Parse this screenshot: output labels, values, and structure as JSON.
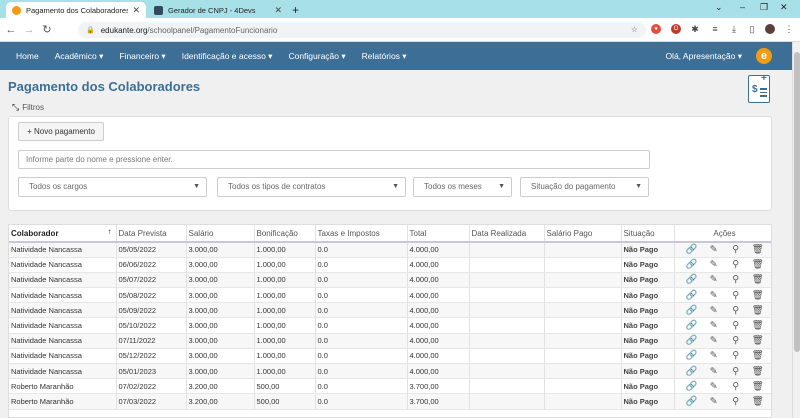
{
  "browser": {
    "tabs": [
      {
        "title": "Pagamento dos Colaboradores",
        "active": true
      },
      {
        "title": "Gerador de CNPJ - 4Devs",
        "active": false
      }
    ],
    "url_host": "edukante.org",
    "url_path": "/schoolpanel/PagamentoFuncionario"
  },
  "nav": {
    "items": [
      "Home",
      "Acadêmico ▾",
      "Financeiro ▾",
      "Identificação e acesso ▾",
      "Configuração ▾",
      "Relatórios ▾"
    ],
    "user": "Olá, Apresentação ▾",
    "logo": "e"
  },
  "page": {
    "title": "Pagamento dos Colaboradores",
    "filters_label": "Filtros",
    "new_button": "+ Novo pagamento",
    "search_placeholder": "Informe parte do nome e pressione enter.",
    "selects": [
      "Todos os cargos",
      "Todos os tipos de contratos",
      "Todos os meses",
      "Situação do pagamento"
    ]
  },
  "table": {
    "headers": [
      "Colaborador",
      "Data Prevista",
      "Salário",
      "Bonificação",
      "Taxas e Impostos",
      "Total",
      "Data Realizada",
      "Salário Pago",
      "Situação",
      "Ações"
    ],
    "rows": [
      [
        "Natividade Nancassa",
        "05/05/2022",
        "3.000,00",
        "1.000,00",
        "0.0",
        "4.000,00",
        "",
        "",
        "Não Pago"
      ],
      [
        "Natividade Nancassa",
        "06/06/2022",
        "3.000,00",
        "1.000,00",
        "0.0",
        "4.000,00",
        "",
        "",
        "Não Pago"
      ],
      [
        "Natividade Nancassa",
        "05/07/2022",
        "3.000,00",
        "1.000,00",
        "0.0",
        "4.000,00",
        "",
        "",
        "Não Pago"
      ],
      [
        "Natividade Nancassa",
        "05/08/2022",
        "3.000,00",
        "1.000,00",
        "0.0",
        "4.000,00",
        "",
        "",
        "Não Pago"
      ],
      [
        "Natividade Nancassa",
        "05/09/2022",
        "3.000,00",
        "1.000,00",
        "0.0",
        "4.000,00",
        "",
        "",
        "Não Pago"
      ],
      [
        "Natividade Nancassa",
        "05/10/2022",
        "3.000,00",
        "1.000,00",
        "0.0",
        "4.000,00",
        "",
        "",
        "Não Pago"
      ],
      [
        "Natividade Nancassa",
        "07/11/2022",
        "3.000,00",
        "1.000,00",
        "0.0",
        "4.000,00",
        "",
        "",
        "Não Pago"
      ],
      [
        "Natividade Nancassa",
        "05/12/2022",
        "3.000,00",
        "1.000,00",
        "0.0",
        "4.000,00",
        "",
        "",
        "Não Pago"
      ],
      [
        "Natividade Nancassa",
        "05/01/2023",
        "3.000,00",
        "1.000,00",
        "0.0",
        "4.000,00",
        "",
        "",
        "Não Pago"
      ],
      [
        "Roberto Maranhão",
        "07/02/2022",
        "3.200,00",
        "500,00",
        "0.0",
        "3.700,00",
        "",
        "",
        "Não Pago"
      ],
      [
        "Roberto Maranhão",
        "07/03/2022",
        "3.200,00",
        "500,00",
        "0.0",
        "3.700,00",
        "",
        "",
        "Não Pago"
      ]
    ],
    "row_actions": [
      "link-icon",
      "edit-icon",
      "search-icon",
      "trash-icon"
    ]
  },
  "colors": {
    "nav_bg": "#3d6e96",
    "title": "#3d6e96",
    "logo": "#f39c12",
    "tabbar": "#a8e0e8"
  }
}
